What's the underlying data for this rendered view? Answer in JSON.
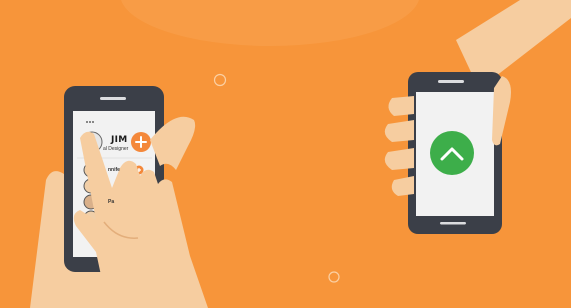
{
  "scene": {
    "colors": {
      "background": "#f7953a",
      "skin": "#f6cda0",
      "skin_shadow": "#e3ae7b",
      "phone_body": "#3b3f48",
      "screen": "#f2f2f2",
      "accent_orange": "#f4883a",
      "success_green": "#3dae4a"
    }
  },
  "left_phone": {
    "profile": {
      "name": "JIM",
      "role": "al Designer"
    },
    "contacts": [
      {
        "label": "nnife"
      },
      {
        "label": "Pa"
      }
    ],
    "icons": [
      "menu-icon",
      "add-icon",
      "add-icon",
      "avatar-icon"
    ]
  },
  "right_phone": {
    "status_icon": "check-icon"
  }
}
